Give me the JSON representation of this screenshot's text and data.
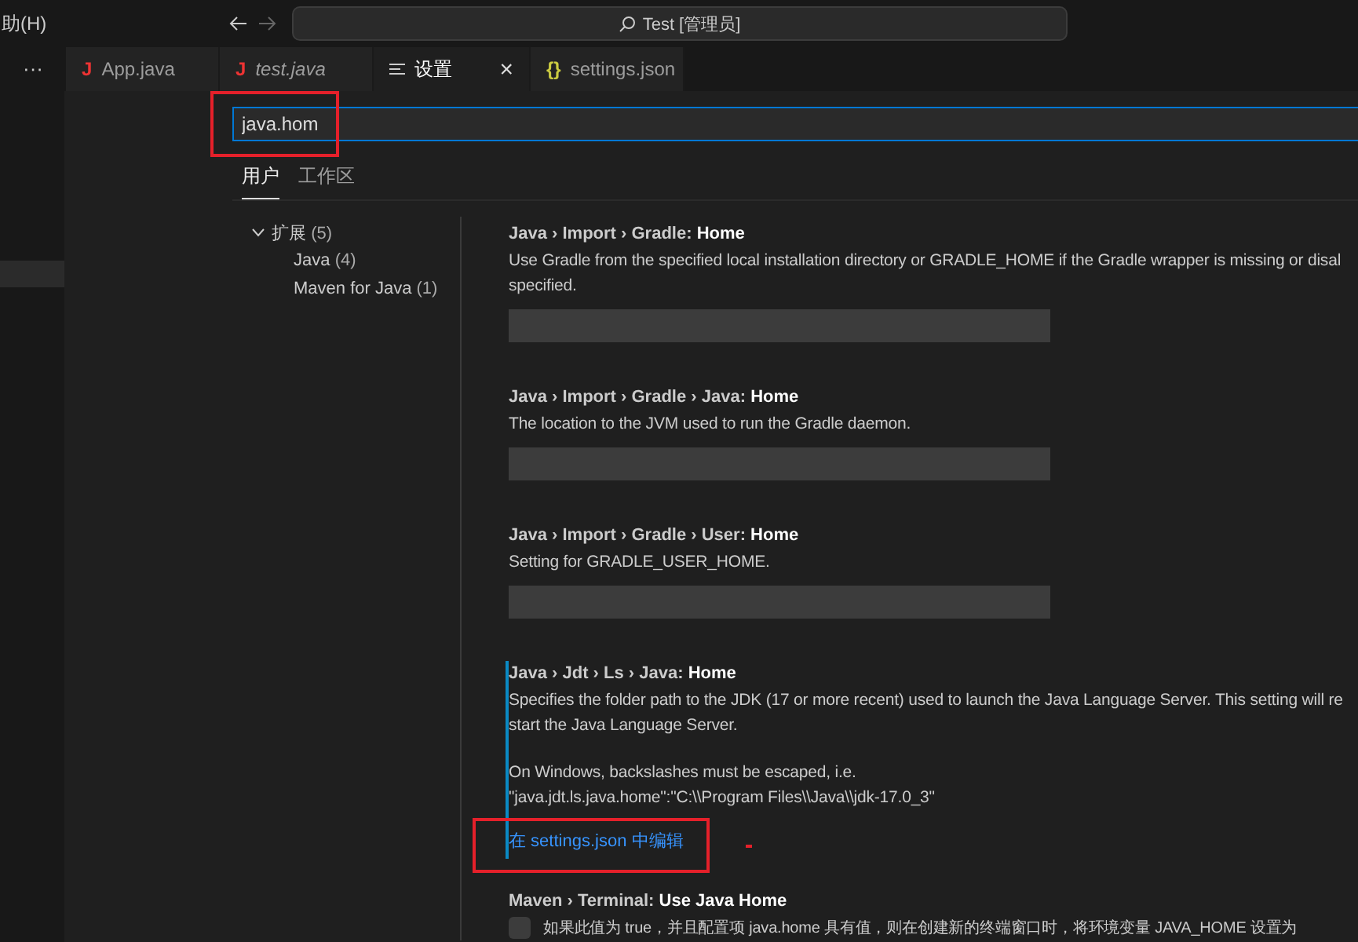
{
  "title_bar": {
    "menu": "助(H)",
    "command_center": "Test [管理员]"
  },
  "more_button": "···",
  "tabs": [
    {
      "kind": "java",
      "glyph": "J",
      "label": "App.java",
      "preview": false,
      "selected": false
    },
    {
      "kind": "java",
      "glyph": "J",
      "label": "test.java",
      "preview": true,
      "selected": false
    },
    {
      "kind": "settings",
      "label": "设置",
      "preview": false,
      "selected": true,
      "close": "×"
    },
    {
      "kind": "json",
      "glyph": "{}",
      "label": "settings.json",
      "preview": false,
      "selected": false
    }
  ],
  "search": {
    "value": "java.hom"
  },
  "scope_tabs": [
    {
      "label": "用户",
      "selected": true
    },
    {
      "label": "工作区",
      "selected": false
    }
  ],
  "toc": [
    {
      "label": "扩展",
      "count": "(5)",
      "expanded": true,
      "children": [
        {
          "label": "Java",
          "count": "(4)"
        },
        {
          "label": "Maven for Java",
          "count": "(1)"
        }
      ]
    }
  ],
  "settings": [
    {
      "kind": "text",
      "title": "Java › Import › Gradle: **Home**",
      "focused": false,
      "paragraphs": [
        [
          "Use Gradle from the specified local installation directory or GRADLE_HOME if the Gradle wrapper is missing or disal",
          "specified."
        ]
      ]
    },
    {
      "kind": "text",
      "title": "Java › Import › Gradle › Java: **Home**",
      "focused": false,
      "paragraphs": [
        [
          "The location to the JVM used to run the Gradle daemon."
        ]
      ]
    },
    {
      "kind": "text",
      "title": "Java › Import › Gradle › User: **Home**",
      "focused": false,
      "paragraphs": [
        [
          "Setting for GRADLE_USER_HOME."
        ]
      ]
    },
    {
      "kind": "link",
      "title": "Java › Jdt › Ls › Java: **Home**",
      "focused": true,
      "paragraphs": [
        [
          "Specifies the folder path to the JDK (17 or more recent) used to launch the Java Language Server. This setting will re",
          "start the Java Language Server."
        ],
        [
          "On Windows, backslashes must be escaped, i.e.",
          "\"java.jdt.ls.java.home\":\"C:\\\\Program Files\\\\Java\\\\jdk-17.0_3\""
        ]
      ],
      "link": "在 settings.json 中编辑"
    },
    {
      "kind": "checkbox",
      "title": "Maven › Terminal: **Use Java Home**",
      "focused": false,
      "checked": false,
      "paragraphs": [
        [
          "如果此值为 true，并且配置项 java.home 具有值，则在创建新的终端窗口时，将环境变量 JAVA_HOME 设置为"
        ]
      ]
    }
  ]
}
